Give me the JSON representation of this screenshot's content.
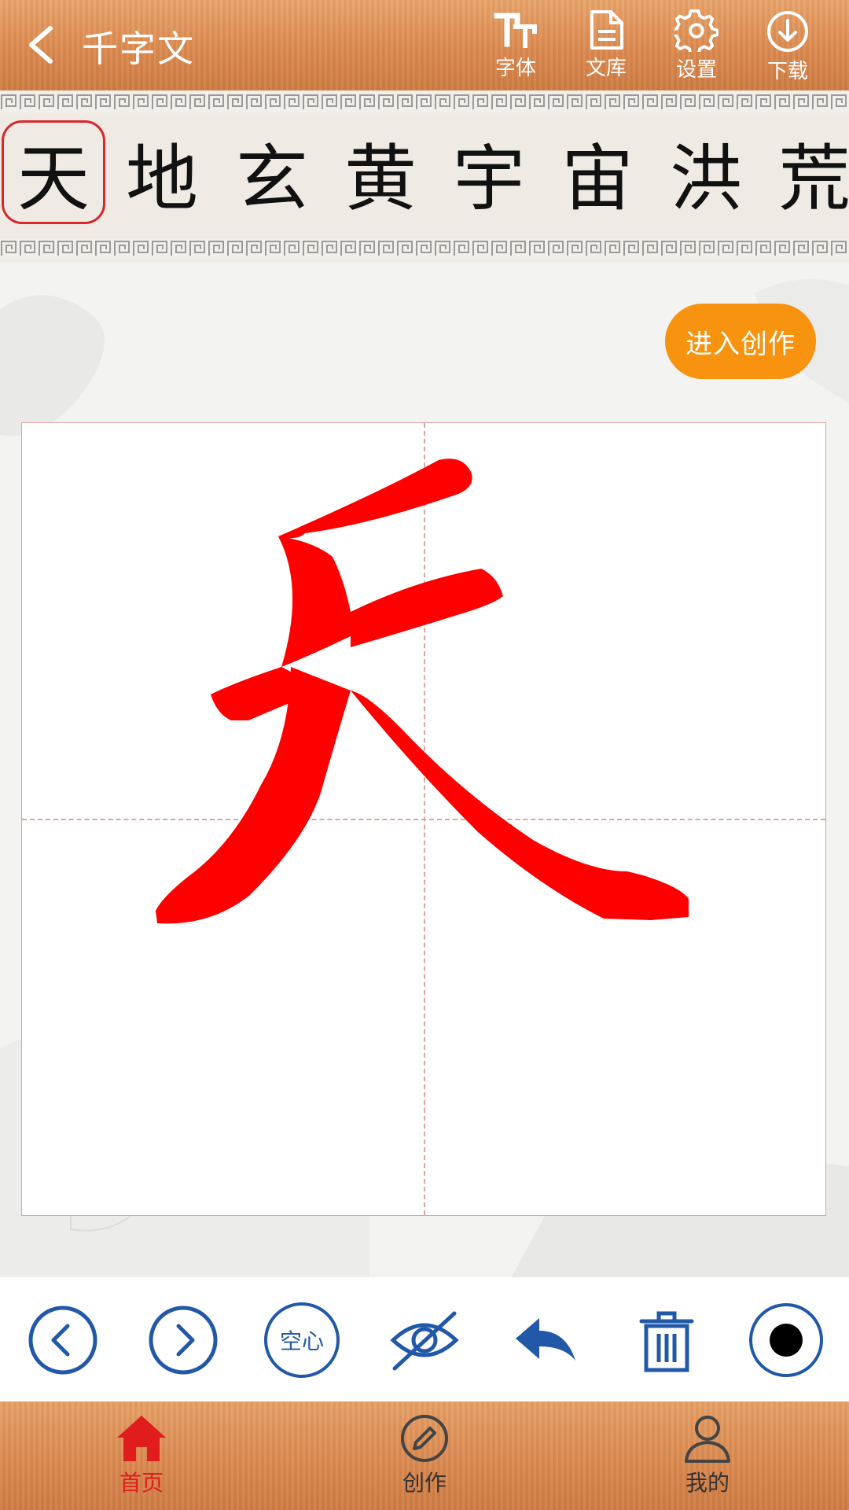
{
  "header": {
    "title": "千字文",
    "tools": [
      {
        "label": "字体",
        "icon": "font-icon"
      },
      {
        "label": "文库",
        "icon": "document-icon"
      },
      {
        "label": "设置",
        "icon": "gear-icon"
      },
      {
        "label": "下载",
        "icon": "download-icon"
      }
    ]
  },
  "characters": [
    "天",
    "地",
    "玄",
    "黄",
    "宇",
    "宙",
    "洪",
    "荒"
  ],
  "selected_index": 0,
  "create_button_label": "进入创作",
  "current_character": "天",
  "current_character_color": "#ff0000",
  "toolbar": {
    "hollow_label": "空心",
    "buttons": [
      "previous-icon",
      "next-icon",
      "hollow-toggle",
      "hide-icon",
      "undo-icon",
      "trash-icon",
      "brush-size-icon"
    ]
  },
  "nav": [
    {
      "label": "首页",
      "icon": "home-icon",
      "active": true
    },
    {
      "label": "创作",
      "icon": "pencil-icon",
      "active": false
    },
    {
      "label": "我的",
      "icon": "user-icon",
      "active": false
    }
  ],
  "colors": {
    "accent_orange": "#f7930f",
    "wood": "#dc8a4f",
    "toolbar_blue": "#2158a8",
    "active_red": "#e01c1c",
    "selection_red": "#d8262b"
  }
}
